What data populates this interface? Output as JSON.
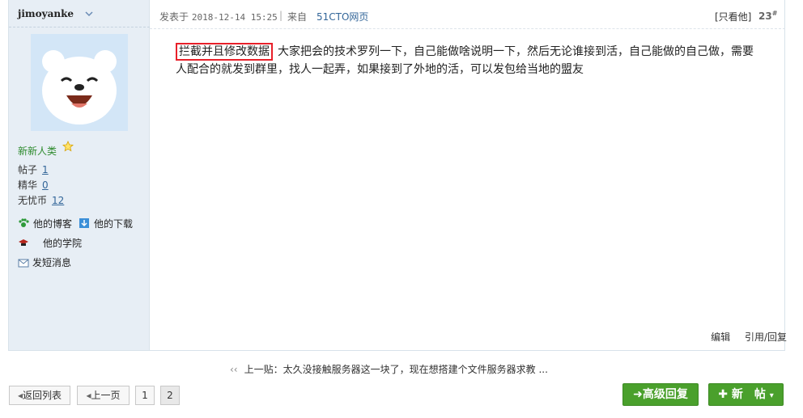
{
  "author": {
    "name": "jimoyanke",
    "group": "新新人类",
    "stats": [
      {
        "label": "帖子",
        "value": "1"
      },
      {
        "label": "精华",
        "value": "0"
      },
      {
        "label": "无忧币",
        "value": "12"
      }
    ],
    "links": {
      "blog": "他的博客",
      "downloads": "他的下载",
      "academy": "他的学院",
      "message": "发短消息"
    }
  },
  "post": {
    "posted_label": "发表于",
    "date": "2018-12-14 15:25",
    "separator": "|",
    "from_label": "来自",
    "from_source": "51CTO网页",
    "only_him": "[只看他]",
    "floor": "23",
    "floor_mark": "#",
    "highlight": "拦截并且修改数据",
    "line1": "大家把会的技术罗列一下，自己能做啥说明一下，然后无论谁接到活，自己能做的自己做，需要",
    "line2": "人配合的就发到群里，找人一起弄，如果接到了外地的活，可以发包给当地的盟友",
    "edit": "编辑",
    "quote_reply": "引用/回复"
  },
  "prev_thread": {
    "arrows": "‹‹",
    "label": "上一贴：",
    "title": "太久没接触服务器这一块了，现在想搭建个文件服务器求教 ..."
  },
  "toolbar": {
    "back_list": "返回列表",
    "prev_page": "上一页",
    "page1": "1",
    "page2": "2",
    "advanced_reply": "高级回复",
    "new_post": "新　帖"
  },
  "colors": {
    "sidebar_bg": "#e7eef5",
    "green_button": "#4aa02c",
    "highlight_border": "#e8202a",
    "link_blue": "#336699"
  }
}
